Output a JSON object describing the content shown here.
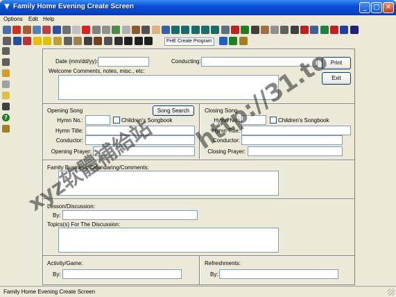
{
  "window": {
    "title": "Family Home Evening Create Screen",
    "minimize_glyph": "_",
    "maximize_glyph": "□",
    "close_glyph": "✕"
  },
  "menu": [
    "Options",
    "Edit",
    "Help"
  ],
  "toolbar": {
    "row1": [
      {
        "icon": "computer-icon",
        "color": "#4a6ea8"
      },
      {
        "icon": "flag-icon",
        "color": "#d03020"
      },
      {
        "icon": "dog-icon",
        "color": "#a06030"
      },
      {
        "icon": "family-icon",
        "color": "#5080c0"
      },
      {
        "icon": "people-icon",
        "color": "#c04040"
      },
      {
        "icon": "umbrella-icon",
        "color": "#3050a0"
      },
      {
        "icon": "utensils-icon",
        "color": "#707070"
      },
      {
        "icon": "blank-icon",
        "color": "#c0c0c0"
      },
      {
        "icon": "first-aid-icon",
        "color": "#e02020"
      },
      {
        "icon": "note-icon",
        "color": "#808080"
      },
      {
        "icon": "envelope-icon",
        "color": "#909090"
      },
      {
        "icon": "picture-icon",
        "color": "#4a8a4a"
      },
      {
        "icon": "document-icon",
        "color": "#b0b0b0"
      },
      {
        "icon": "bear-icon",
        "color": "#8a5a2a"
      },
      {
        "icon": "bug-icon",
        "color": "#505050"
      },
      {
        "icon": "hand-icon",
        "color": "#e0b080"
      },
      {
        "icon": "calendar-icon",
        "color": "#3060b0"
      },
      {
        "icon": "book-icon",
        "color": "#1a6a6a"
      },
      {
        "icon": "book-icon",
        "color": "#1a6a6a"
      },
      {
        "icon": "book-icon",
        "color": "#1a6a6a"
      },
      {
        "icon": "book-icon",
        "color": "#1a6a6a"
      },
      {
        "icon": "book-icon",
        "color": "#1a6a6a"
      },
      {
        "icon": "notebook-icon",
        "color": "#607080"
      },
      {
        "icon": "car-icon",
        "color": "#c02020"
      },
      {
        "icon": "car-icon",
        "color": "#208020"
      },
      {
        "icon": "ship-icon",
        "color": "#404040"
      },
      {
        "icon": "bird-icon",
        "color": "#a07040"
      },
      {
        "icon": "dove-icon",
        "color": "#909090"
      },
      {
        "icon": "pencil-icon",
        "color": "#606060"
      },
      {
        "icon": "pen-icon",
        "color": "#404040"
      },
      {
        "icon": "game-icon",
        "color": "#c02020"
      },
      {
        "icon": "pet-icon",
        "color": "#406090"
      },
      {
        "icon": "checklist-icon",
        "color": "#208040"
      },
      {
        "icon": "ornament-icon",
        "color": "#c02020"
      },
      {
        "icon": "chart-icon",
        "color": "#2040a0"
      },
      {
        "icon": "clock-icon",
        "color": "#202080"
      }
    ],
    "row2": [
      {
        "icon": "printer-icon",
        "color": "#606060"
      },
      {
        "icon": "book-icon",
        "color": "#2050a0"
      },
      {
        "icon": "church-icon",
        "color": "#c03030"
      },
      {
        "icon": "smiley-icon",
        "color": "#e0c000"
      },
      {
        "icon": "smiley-icon",
        "color": "#e0c000"
      },
      {
        "icon": "lamp-icon",
        "color": "#c0a030"
      },
      {
        "icon": "number-icon",
        "color": "#606060"
      },
      {
        "icon": "scroll-icon",
        "color": "#a08050"
      },
      {
        "icon": "lock-icon",
        "color": "#404040"
      },
      {
        "icon": "abacus-icon",
        "color": "#704020"
      },
      {
        "icon": "grid-icon",
        "color": "#505050"
      },
      {
        "icon": "book-icon",
        "color": "#303030"
      },
      {
        "icon": "cross-icon",
        "color": "#202020"
      },
      {
        "icon": "candle-icon",
        "color": "#202020"
      },
      {
        "icon": "cross-icon",
        "color": "#202020"
      }
    ],
    "program_label": "FHE Create Program",
    "row2_after": [
      {
        "icon": "globe-icon",
        "color": "#2060c0"
      },
      {
        "icon": "help-icon",
        "color": "#208020"
      },
      {
        "icon": "export-icon",
        "color": "#a08020"
      }
    ]
  },
  "leftbar": [
    {
      "icon": "family-icon",
      "color": "#606060"
    },
    {
      "icon": "reload-icon",
      "color": "#606060"
    },
    {
      "icon": "chart-icon",
      "color": "#d0a020"
    },
    {
      "icon": "blank-icon",
      "color": "#a0a0a0"
    },
    {
      "icon": "note-icon",
      "color": "#e0c040"
    },
    {
      "icon": "tree-icon",
      "color": "#404040"
    },
    {
      "icon": "help-icon",
      "color": "#208020"
    },
    {
      "icon": "exit-icon",
      "color": "#a08020"
    }
  ],
  "form": {
    "date_label": "Date (mm/dd/yy):",
    "date_value": "",
    "conducting_label": "Conducting:",
    "conducting_value": "",
    "print_button": "Print",
    "exit_button": "Exit",
    "welcome_label": "Welcome Comments, notes, misc., etc:",
    "opening_song": {
      "heading": "Opening Song",
      "search_button": "Song Search",
      "hymn_no_label": "Hymn No.:",
      "childrens_label": "Children's Songbook",
      "hymn_title_label": "Hymn Title:",
      "conductor_label": "Conductor:",
      "prayer_label": "Opening Prayer:"
    },
    "closing_song": {
      "heading": "Closing Song",
      "hymn_no_label": "Hymn No.:",
      "childrens_label": "Children's Songbook",
      "hymn_title_label": "Hymn Title:",
      "conductor_label": "Conductor:",
      "prayer_label": "Closing Prayer:"
    },
    "business_label": "Family Business/Calendaring/Comments:",
    "lesson_label": "Lesson/Discussion:",
    "lesson_by_label": "By:",
    "topics_label": "Topics(s) For The Discussion:",
    "activity_label": "Activity/Game:",
    "activity_by_label": "By:",
    "refreshments_label": "Refreshments:",
    "refreshments_by_label": "By:"
  },
  "status": "Family Home Evening Create Screen",
  "watermark": {
    "text1": "xyz软體補給站",
    "text2": "http://31.to"
  }
}
